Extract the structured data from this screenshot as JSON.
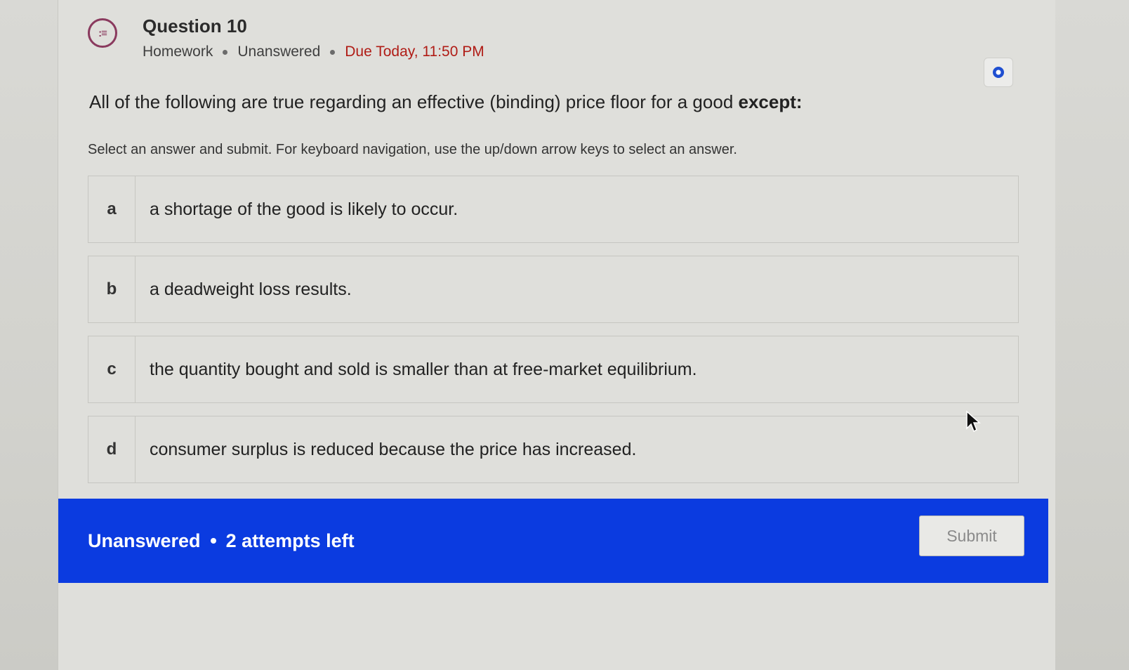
{
  "header": {
    "icon": "question-list-icon",
    "title": "Question 10",
    "type": "Homework",
    "status": "Unanswered",
    "due": "Due Today, 11:50 PM"
  },
  "question": {
    "prompt": "All of the following are true regarding an effective (binding) price floor for a good",
    "emphasis": "except:",
    "instructions": "Select an answer and submit. For keyboard navigation, use the up/down arrow keys to select an answer."
  },
  "options": [
    {
      "letter": "a",
      "text": "a shortage of the good is likely to occur."
    },
    {
      "letter": "b",
      "text": "a deadweight loss results."
    },
    {
      "letter": "c",
      "text": "the quantity bought and sold is smaller than at free-market equilibrium."
    },
    {
      "letter": "d",
      "text": "consumer surplus is reduced because the price has increased."
    }
  ],
  "footer": {
    "status": "Unanswered",
    "attempts": "2 attempts left",
    "submit_label": "Submit"
  },
  "colors": {
    "accent": "#0b3be0",
    "due": "#b01c16",
    "icon": "#8a3a5e"
  }
}
